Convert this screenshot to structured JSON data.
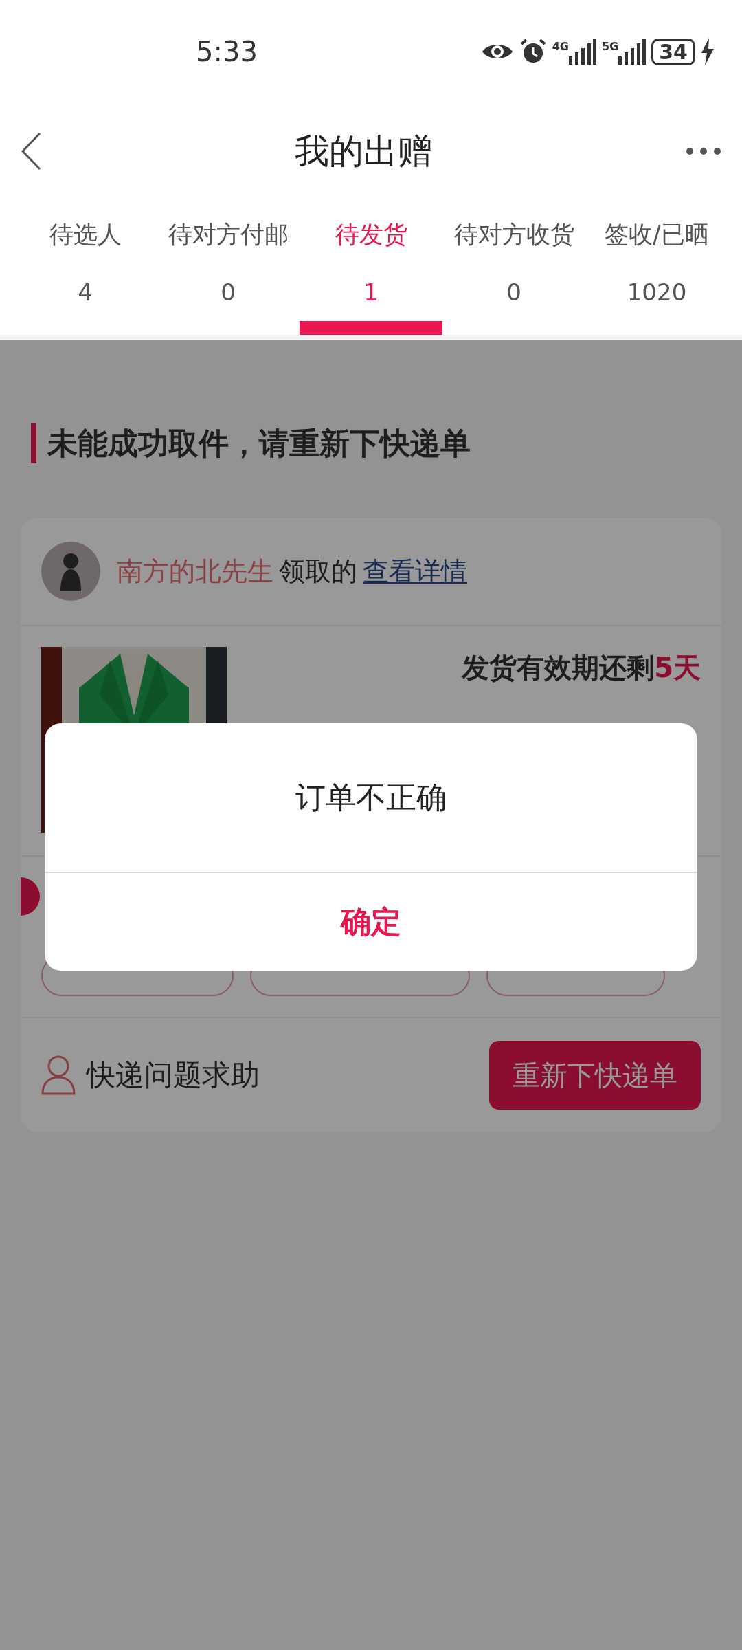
{
  "status_bar": {
    "time": "5:33",
    "networks": [
      "4G",
      "5G"
    ],
    "battery": "34"
  },
  "header": {
    "title": "我的出赠"
  },
  "tabs": [
    {
      "label": "待选人",
      "count": "4",
      "selected": false
    },
    {
      "label": "待对方付邮",
      "count": "0",
      "selected": false
    },
    {
      "label": "待发货",
      "count": "1",
      "selected": true
    },
    {
      "label": "待对方收货",
      "count": "0",
      "selected": false
    },
    {
      "label": "签收/已晒",
      "count": "1020",
      "selected": false
    }
  ],
  "notice": {
    "title": "未能成功取件，请重新下快递单"
  },
  "order": {
    "receiver": "南方的北先生",
    "received_text": "领取的",
    "details_link": "查看详情",
    "deadline": "发货有效期还剩**5天**",
    "help": "快递问题求助",
    "reorder_button": "重新下快递单"
  },
  "dialog": {
    "message": "订单不正确",
    "confirm_button": "确定"
  }
}
